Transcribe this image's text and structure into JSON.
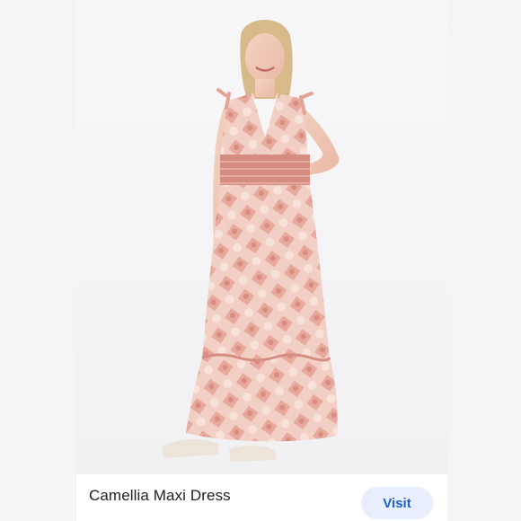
{
  "product": {
    "title": "Camellia Maxi Dress",
    "visit_label": "Visit"
  },
  "colors": {
    "accent": "#1a5fd6",
    "visit_bg": "#e8eefc",
    "dress": "#e9b6aa"
  },
  "image": {
    "icon": "model-photo"
  }
}
